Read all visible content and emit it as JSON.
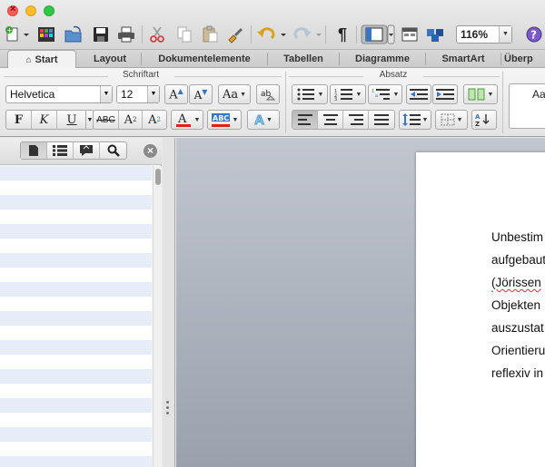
{
  "toolbar": {
    "zoom": "116%"
  },
  "ribbon_tabs": [
    {
      "label": "Start"
    },
    {
      "label": "Layout"
    },
    {
      "label": "Dokumentelemente"
    },
    {
      "label": "Tabellen"
    },
    {
      "label": "Diagramme"
    },
    {
      "label": "SmartArt"
    },
    {
      "label": "Überp"
    }
  ],
  "groups": {
    "schriftart": "Schriftart",
    "absatz": "Absatz"
  },
  "font": {
    "name": "Helvetica",
    "size": "12"
  },
  "styles_preview": "Aa",
  "document": {
    "lines": [
      "Unbestim",
      "aufgebaut",
      "(Jörissen",
      "Objekten",
      "auszustat",
      "Orientieru",
      "reflexiv in"
    ]
  },
  "colors": {
    "font_color_bar": "#e02020",
    "highlight_bar": "#e02020",
    "accent_blue": "#3a74c4"
  }
}
